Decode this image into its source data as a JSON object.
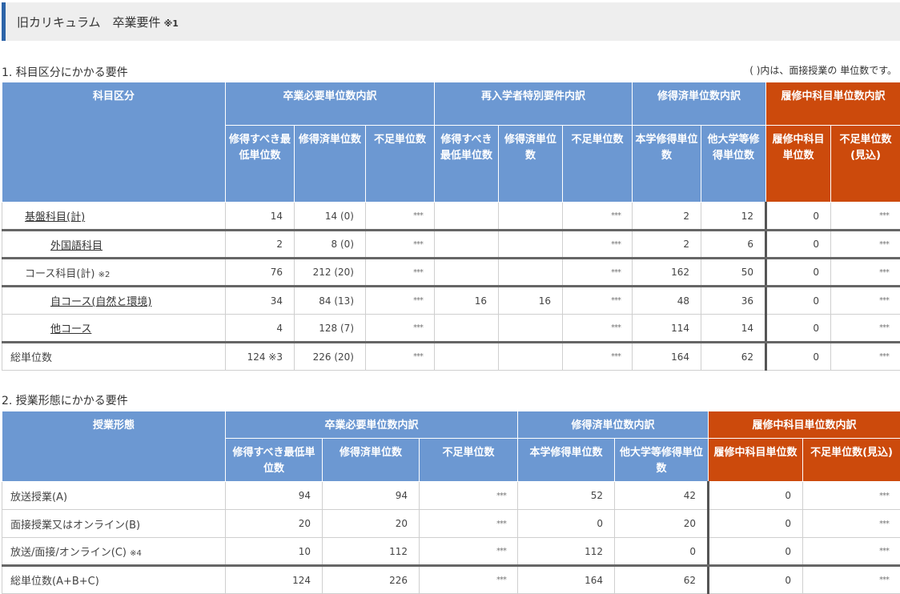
{
  "header": {
    "title": "旧カリキュラム　卒業要件",
    "note": "※1"
  },
  "section1": {
    "title": "1. 科目区分にかかる要件",
    "note": "( )内は、面接授業の 単位数です。",
    "headers": {
      "category": "科目区分",
      "grad_group": "卒業必要単位数内訳",
      "readmit_group": "再入学者特別要件内訳",
      "earned_group": "修得済単位数内訳",
      "enrolled_group": "履修中科目単位数内訳",
      "grad_min": "修得すべき最低単位数",
      "grad_earned": "修得済単位数",
      "grad_short": "不足単位数",
      "re_min": "修得すべき最低単位数",
      "re_earned": "修得済単位数",
      "re_short": "不足単位数",
      "own": "本学修得単位数",
      "other": "他大学等修得単位数",
      "enr": "履修中科目単位数",
      "enr_short": "不足単位数(見込)"
    },
    "rows": [
      {
        "label": "基盤科目(計)",
        "min": "14",
        "earned": "14 (0)",
        "short": "***",
        "re_min": "",
        "re_earned": "",
        "re_short": "***",
        "own": "2",
        "other": "12",
        "enr": "0",
        "enr_short": "***"
      },
      {
        "label": "外国語科目",
        "min": "2",
        "earned": "8 (0)",
        "short": "***",
        "re_min": "",
        "re_earned": "",
        "re_short": "***",
        "own": "2",
        "other": "6",
        "enr": "0",
        "enr_short": "***"
      },
      {
        "label": "コース科目(計)",
        "label_note": "※2",
        "min": "76",
        "earned": "212 (20)",
        "short": "***",
        "re_min": "",
        "re_earned": "",
        "re_short": "***",
        "own": "162",
        "other": "50",
        "enr": "0",
        "enr_short": "***"
      },
      {
        "label": "自コース(自然と環境)",
        "min": "34",
        "earned": "84 (13)",
        "short": "***",
        "re_min": "16",
        "re_earned": "16",
        "re_short": "***",
        "own": "48",
        "other": "36",
        "enr": "0",
        "enr_short": "***"
      },
      {
        "label": "他コース",
        "min": "4",
        "earned": "128 (7)",
        "short": "***",
        "re_min": "",
        "re_earned": "",
        "re_short": "***",
        "own": "114",
        "other": "14",
        "enr": "0",
        "enr_short": "***"
      },
      {
        "label": "総単位数",
        "min": "124 ※3",
        "earned": "226 (20)",
        "short": "***",
        "re_min": "",
        "re_earned": "",
        "re_short": "***",
        "own": "164",
        "other": "62",
        "enr": "0",
        "enr_short": "***"
      }
    ]
  },
  "section2": {
    "title": "2. 授業形態にかかる要件",
    "headers": {
      "type": "授業形態",
      "grad_group": "卒業必要単位数内訳",
      "earned_group": "修得済単位数内訳",
      "enrolled_group": "履修中科目単位数内訳",
      "grad_min": "修得すべき最低単位数",
      "grad_earned": "修得済単位数",
      "grad_short": "不足単位数",
      "own": "本学修得単位数",
      "other": "他大学等修得単位数",
      "enr": "履修中科目単位数",
      "enr_short": "不足単位数(見込)"
    },
    "rows": [
      {
        "label": "放送授業(A)",
        "min": "94",
        "earned": "94",
        "short": "***",
        "own": "52",
        "other": "42",
        "enr": "0",
        "enr_short": "***"
      },
      {
        "label": "面接授業又はオンライン(B)",
        "min": "20",
        "earned": "20",
        "short": "***",
        "own": "0",
        "other": "20",
        "enr": "0",
        "enr_short": "***"
      },
      {
        "label": "放送/面接/オンライン(C)",
        "label_note": "※4",
        "min": "10",
        "earned": "112",
        "short": "***",
        "own": "112",
        "other": "0",
        "enr": "0",
        "enr_short": "***"
      },
      {
        "label": "総単位数(A+B+C)",
        "min": "124",
        "earned": "226",
        "short": "***",
        "own": "164",
        "other": "62",
        "enr": "0",
        "enr_short": "***"
      }
    ]
  },
  "colors": {
    "header_blue": "#6c98d2",
    "header_orange": "#cc4a0c",
    "accent_bar": "#2d64a8"
  }
}
